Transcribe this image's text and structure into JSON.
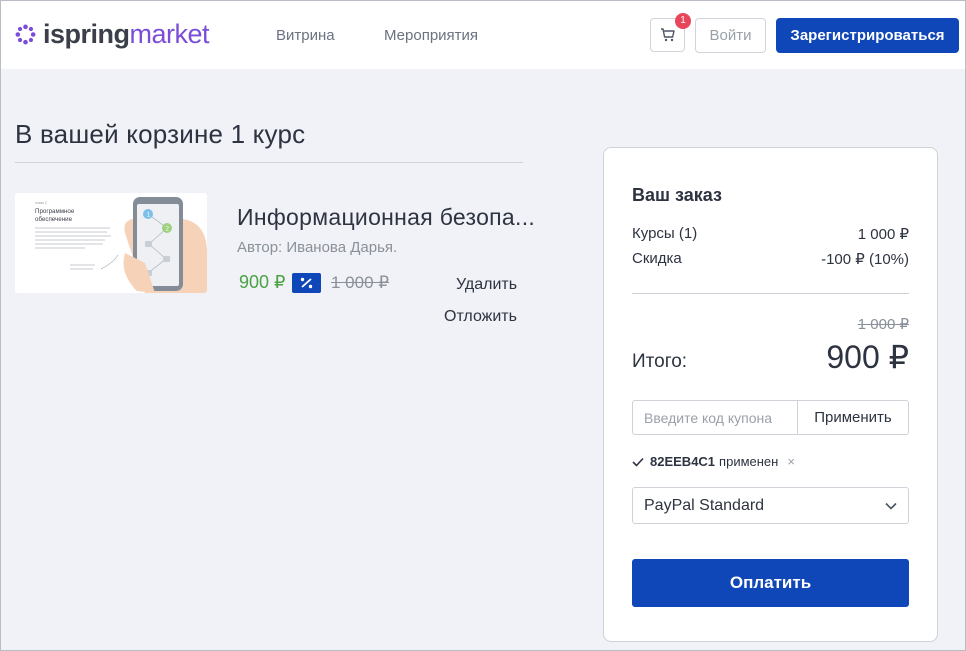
{
  "header": {
    "logo": {
      "part1": "ispring",
      "part2": "market"
    },
    "nav": [
      "Витрина",
      "Мероприятия"
    ],
    "cart_badge": "1",
    "login_label": "Войти",
    "register_label": "Зарегистрироваться"
  },
  "cart": {
    "title": "В вашей корзине 1 курс",
    "items": [
      {
        "title": "Информационная безопа...",
        "author": "Автор: Иванова Дарья.",
        "price": "900 ₽",
        "old_price": "1 000 ₽",
        "delete_label": "Удалить",
        "postpone_label": "Отложить",
        "thumbnail": {
          "heading": "Программное обеспечение",
          "steps": [
            "1",
            "2"
          ]
        }
      }
    ]
  },
  "order": {
    "title": "Ваш заказ",
    "courses_label": "Курсы (1)",
    "courses_value": "1 000 ₽",
    "discount_label": "Скидка",
    "discount_value": "-100 ₽ (10%)",
    "total_old": "1 000 ₽",
    "total_label": "Итого:",
    "total_value": "900 ₽",
    "coupon": {
      "placeholder": "Введите код купона",
      "apply_label": "Применить",
      "applied_code": "82EEB4C1",
      "applied_text": "применен",
      "remove_symbol": "×"
    },
    "payment_method": "PayPal Standard",
    "pay_label": "Оплатить"
  },
  "colors": {
    "brand_blue": "#0f46b8",
    "logo_purple": "#7a4ed8",
    "price_green": "#4aa243",
    "badge_red": "#e8455b"
  },
  "icons": [
    "ispring-logo-icon",
    "cart-icon",
    "discount-icon",
    "check-icon",
    "chevron-down-icon",
    "close-icon"
  ]
}
